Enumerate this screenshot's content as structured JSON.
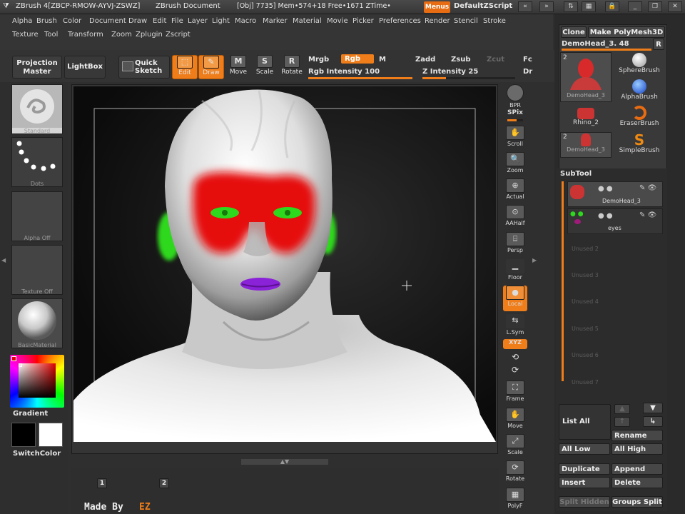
{
  "titlebar": {
    "app": "ZBrush 4[ZBCP-RMOW-AYVJ-ZSWZ]",
    "document": "ZBrush Document",
    "stats": "[Obj] 7735] Mem•574+18  Free•1671  ZTime•",
    "menus_label": "Menus",
    "script_label": "DefaultZScript"
  },
  "menubar": {
    "row1": [
      "Alpha",
      "Brush",
      "Color",
      "Document",
      "Draw",
      "Edit",
      "File",
      "Layer",
      "Light",
      "Macro",
      "Marker",
      "Material",
      "Movie",
      "Picker",
      "Preferences",
      "Render",
      "Stencil",
      "Stroke"
    ],
    "row2": [
      "Texture",
      "Tool",
      "Transform",
      "Zoom",
      "Zplugin",
      "Zscript"
    ]
  },
  "shelf": {
    "projection_master": "Projection Master",
    "lightbox": "LightBox",
    "quick_sketch": "Quick Sketch",
    "edit": "Edit",
    "draw": "Draw",
    "move": "Move",
    "scale": "Scale",
    "rotate": "Rotate",
    "mrgb": "Mrgb",
    "rgb": "Rgb",
    "m": "M",
    "zadd": "Zadd",
    "zsub": "Zsub",
    "zcut": "Zcut",
    "focal": "Fc",
    "rgb_intensity": "Rgb  Intensity 100",
    "rgb_intensity_value": 1.0,
    "z_intensity": "Z Intensity 25",
    "z_intensity_value": 0.25,
    "dr": "Dr"
  },
  "leftpanel": {
    "standard": "Standard",
    "dots": "Dots",
    "alpha_off": "Alpha  Off",
    "texture_off": "Texture  Off",
    "basic_material": "BasicMaterial",
    "gradient": "Gradient",
    "switch_color": "SwitchColor",
    "main_color": "#ffffff",
    "secondary_color": "#000000"
  },
  "righttools": {
    "bpr": "BPR",
    "spix": "SPix",
    "scroll": "Scroll",
    "zoom": "Zoom",
    "actual": "Actual",
    "aahalf": "AAHalf",
    "persp": "Persp",
    "floor": "Floor",
    "local": "Local",
    "lsym": "L.Sym",
    "xyz": "XYZ",
    "frame": "Frame",
    "move": "Move",
    "scale": "Scale",
    "rotate": "Rotate",
    "polyf": "PolyF"
  },
  "tray": {
    "clone": "Clone",
    "make_polymesh": "Make PolyMesh3D",
    "current_tool": "DemoHead_3. 48",
    "r_button": "R",
    "tools": [
      {
        "label": "DemoHead_3",
        "badge": "2"
      },
      {
        "label": "SphereBrush",
        "badge": ""
      },
      {
        "label": "AlphaBrush",
        "badge": ""
      },
      {
        "label": "Rhino_2",
        "badge": ""
      },
      {
        "label": "EraserBrush",
        "badge": ""
      },
      {
        "label": "DemoHead_3",
        "badge": "2"
      },
      {
        "label": "SimpleBrush",
        "badge": ""
      }
    ],
    "subtool_title": "SubTool",
    "subtools": [
      "DemoHead_3",
      "eyes"
    ],
    "unused": [
      "Unused 2",
      "Unused 3",
      "Unused 4",
      "Unused 5",
      "Unused 6",
      "Unused 7"
    ],
    "list_all": "List All",
    "rename": "Rename",
    "all_low": "All Low",
    "all_high": "All High",
    "duplicate": "Duplicate",
    "append": "Append",
    "insert": "Insert",
    "delete": "Delete",
    "split_hidden": "Split Hidden",
    "groups_split": "Groups Split"
  },
  "bottom": {
    "marker1": "1",
    "marker2": "2",
    "made_by": "Made By",
    "author": "EZ"
  },
  "colors": {
    "accent": "#ef7d1a",
    "paint_red": "#e61010",
    "eye_green": "#2ed81c",
    "lip_purple": "#8a22d8"
  }
}
